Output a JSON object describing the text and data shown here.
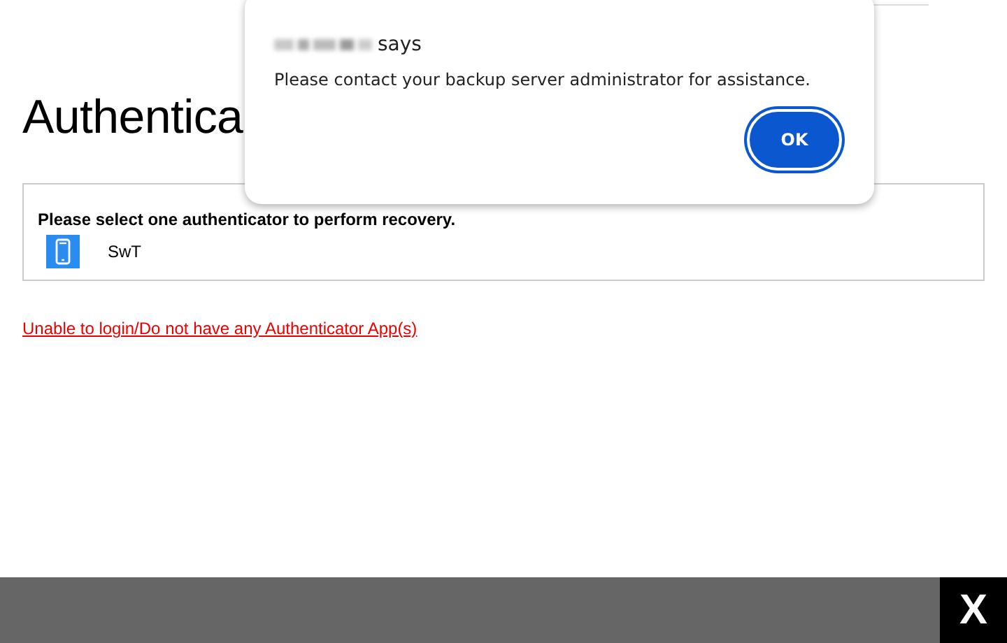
{
  "page": {
    "heading": "Authentica",
    "panel": {
      "prompt": "Please select one authenticator to perform recovery.",
      "authenticators": [
        {
          "label": "SwT"
        }
      ]
    },
    "help_link": "Unable to login/Do not have any Authenticator App(s)"
  },
  "dialog": {
    "title": "says",
    "message": "Please contact your backup server administrator for assistance.",
    "button": "OK"
  },
  "footer": {
    "close_label": "X"
  }
}
